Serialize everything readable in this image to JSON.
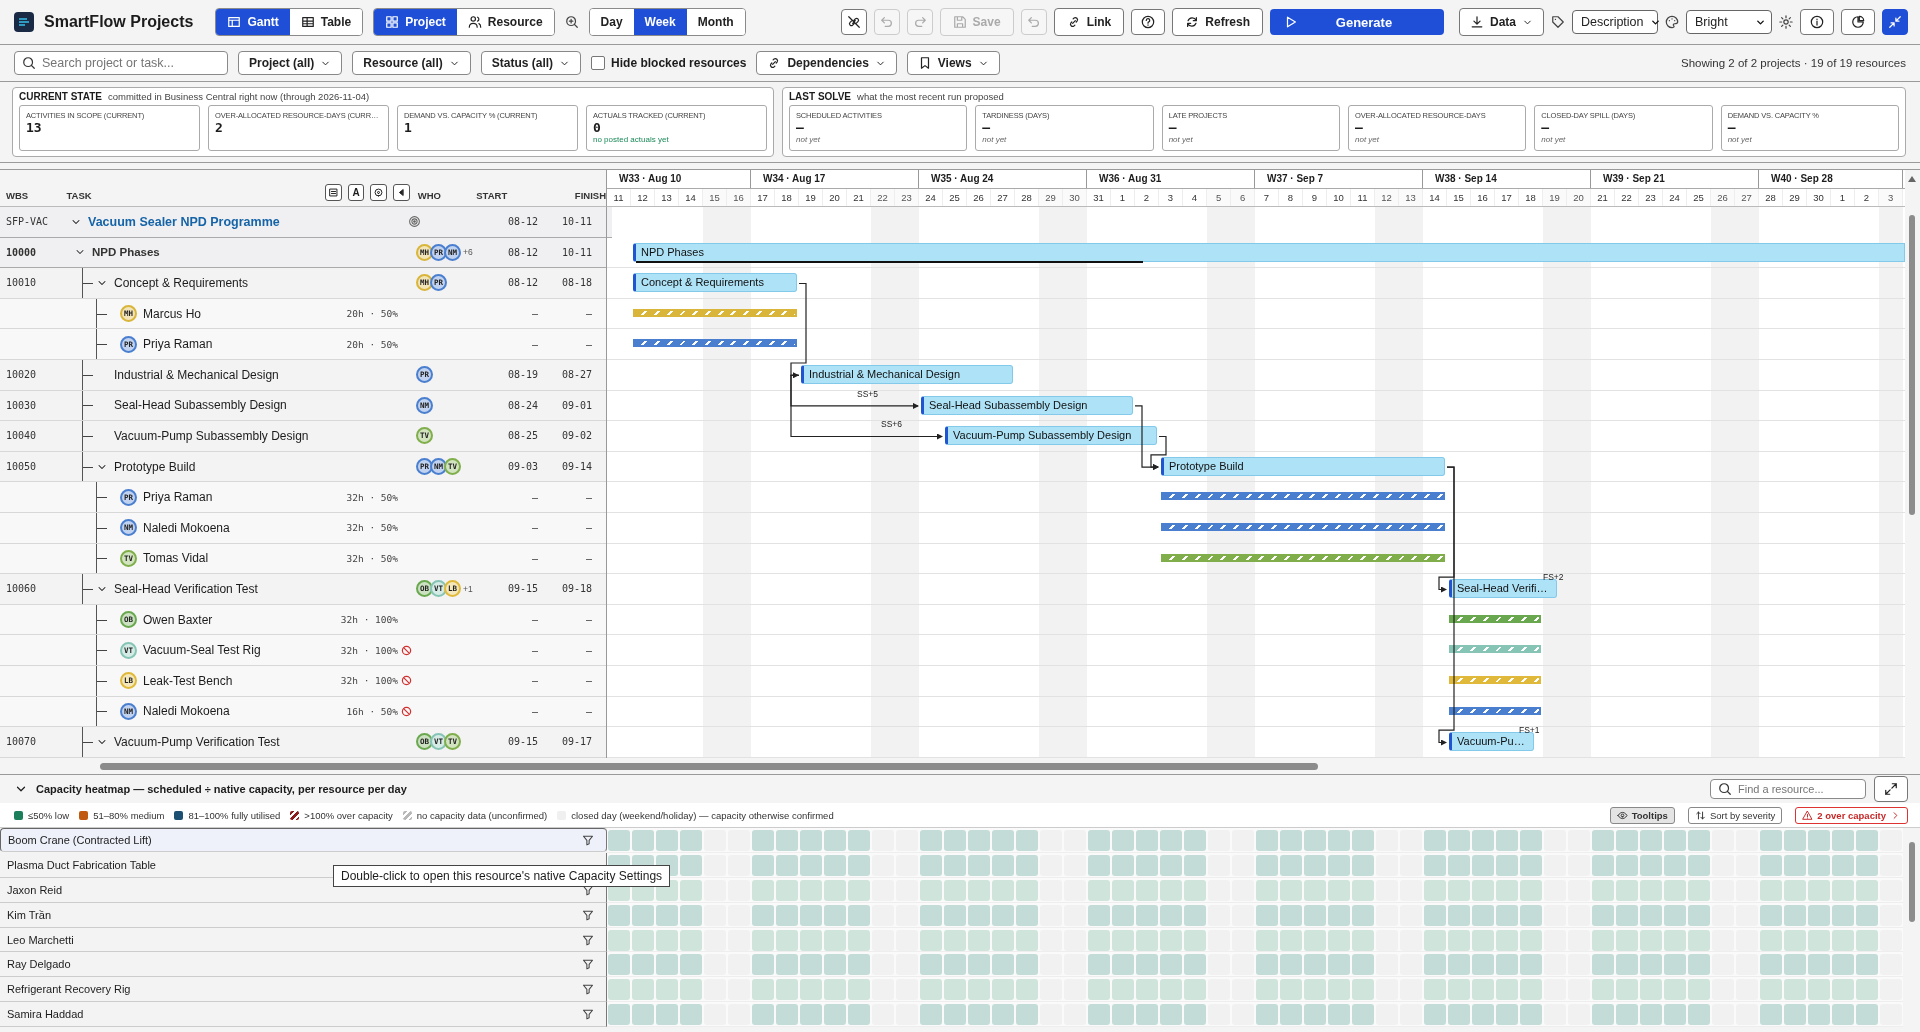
{
  "app": {
    "title": "SmartFlow Projects"
  },
  "view_tabs": [
    {
      "label": "Gantt",
      "selected": true
    },
    {
      "label": "Table",
      "selected": false
    }
  ],
  "mode_tabs": [
    {
      "label": "Project",
      "selected": true
    },
    {
      "label": "Resource",
      "selected": false
    }
  ],
  "scale_tabs": [
    {
      "label": "Day",
      "selected": false
    },
    {
      "label": "Week",
      "selected": true
    },
    {
      "label": "Month",
      "selected": false
    }
  ],
  "toolbar": {
    "undo_disabled": true,
    "redo_disabled": true,
    "save": {
      "label": "Save",
      "disabled": true
    },
    "revert_disabled": true,
    "link": "Link",
    "refresh": "Refresh",
    "generate": "Generate",
    "data": "Data",
    "label_select": "Description",
    "theme_select": "Bright"
  },
  "filters": {
    "search": {
      "placeholder": "Search project or task..."
    },
    "dropdowns": [
      "Project (all)",
      "Resource (all)",
      "Status (all)"
    ],
    "hide_blocked": {
      "label": "Hide blocked resources",
      "checked": false
    },
    "dependencies": "Dependencies",
    "views": "Views",
    "summary": "Showing 2 of 2 projects · 19 of 19 resources"
  },
  "current_state": {
    "title": "CURRENT STATE",
    "subtitle": "committed in Business Central right now (through 2026-11-04)",
    "cards": [
      {
        "label": "ACTIVITIES IN SCOPE (CURRENT)",
        "value": "13"
      },
      {
        "label": "OVER-ALLOCATED RESOURCE-DAYS (CURR…",
        "value": "2"
      },
      {
        "label": "DEMAND VS. CAPACITY % (CURRENT)",
        "value": "1"
      },
      {
        "label": "ACTUALS TRACKED (CURRENT)",
        "value": "0",
        "note": "no posted actuals yet"
      }
    ]
  },
  "last_solve": {
    "title": "LAST SOLVE",
    "subtitle": "what the most recent run proposed",
    "cards": [
      {
        "label": "SCHEDULED ACTIVITIES",
        "value": "—",
        "note": "not yet"
      },
      {
        "label": "TARDINESS (DAYS)",
        "value": "—",
        "note": "not yet"
      },
      {
        "label": "LATE PROJECTS",
        "value": "—",
        "note": "not yet"
      },
      {
        "label": "OVER-ALLOCATED RESOURCE-DAYS",
        "value": "—",
        "note": "not yet"
      },
      {
        "label": "CLOSED-DAY SPILL (DAYS)",
        "value": "—",
        "note": "not yet"
      },
      {
        "label": "DEMAND VS. CAPACITY %",
        "value": "—",
        "note": "not yet"
      }
    ]
  },
  "timeline": {
    "weeks": [
      {
        "label": "W33 · Aug 10",
        "days": [
          {
            "label": "11",
            "closed": false
          },
          {
            "label": "12",
            "closed": false
          },
          {
            "label": "13",
            "closed": false
          },
          {
            "label": "14",
            "closed": false
          },
          {
            "label": "15",
            "closed": true
          },
          {
            "label": "16",
            "closed": true
          }
        ]
      },
      {
        "label": "W34 · Aug 17",
        "days": [
          {
            "label": "17",
            "closed": false
          },
          {
            "label": "18",
            "closed": false
          },
          {
            "label": "19",
            "closed": false
          },
          {
            "label": "20",
            "closed": false
          },
          {
            "label": "21",
            "closed": false
          },
          {
            "label": "22",
            "closed": true
          },
          {
            "label": "23",
            "closed": true
          }
        ]
      },
      {
        "label": "W35 · Aug 24",
        "days": [
          {
            "label": "24",
            "closed": false
          },
          {
            "label": "25",
            "closed": false
          },
          {
            "label": "26",
            "closed": false
          },
          {
            "label": "27",
            "closed": false
          },
          {
            "label": "28",
            "closed": false
          },
          {
            "label": "29",
            "closed": true
          },
          {
            "label": "30",
            "closed": true
          }
        ]
      },
      {
        "label": "W36 · Aug 31",
        "days": [
          {
            "label": "31",
            "closed": false
          },
          {
            "label": "1",
            "closed": false
          },
          {
            "label": "2",
            "closed": false
          },
          {
            "label": "3",
            "closed": false
          },
          {
            "label": "4",
            "closed": false
          },
          {
            "label": "5",
            "closed": true
          },
          {
            "label": "6",
            "closed": true
          }
        ]
      },
      {
        "label": "W37 · Sep 7",
        "days": [
          {
            "label": "7",
            "closed": false
          },
          {
            "label": "8",
            "closed": false
          },
          {
            "label": "9",
            "closed": false
          },
          {
            "label": "10",
            "closed": false
          },
          {
            "label": "11",
            "closed": false
          },
          {
            "label": "12",
            "closed": true
          },
          {
            "label": "13",
            "closed": true
          }
        ]
      },
      {
        "label": "W38 · Sep 14",
        "days": [
          {
            "label": "14",
            "closed": false
          },
          {
            "label": "15",
            "closed": false
          },
          {
            "label": "16",
            "closed": false
          },
          {
            "label": "17",
            "closed": false
          },
          {
            "label": "18",
            "closed": false
          },
          {
            "label": "19",
            "closed": true
          },
          {
            "label": "20",
            "closed": true
          }
        ]
      },
      {
        "label": "W39 · Sep 21",
        "days": [
          {
            "label": "21",
            "closed": false
          },
          {
            "label": "22",
            "closed": false
          },
          {
            "label": "23",
            "closed": false
          },
          {
            "label": "24",
            "closed": false
          },
          {
            "label": "25",
            "closed": false
          },
          {
            "label": "26",
            "closed": true
          },
          {
            "label": "27",
            "closed": true
          }
        ]
      },
      {
        "label": "W40 · Sep 28",
        "days": [
          {
            "label": "28",
            "closed": false
          },
          {
            "label": "29",
            "closed": false
          },
          {
            "label": "30",
            "closed": false
          },
          {
            "label": "1",
            "closed": false
          },
          {
            "label": "2",
            "closed": false
          },
          {
            "label": "3",
            "closed": true
          }
        ]
      }
    ]
  },
  "gantt": {
    "columns": [
      "WBS",
      "TASK",
      "WHO",
      "START",
      "FINISH"
    ],
    "font_toggle": "A",
    "rows": [
      {
        "kind": "project",
        "wbs": "SFP-VAC",
        "name": "Vacuum Sealer NPD Programme",
        "start": "08-12",
        "finish": "10-11",
        "expanded": true,
        "children": [
          {
            "kind": "summary",
            "wbs": "10000",
            "name": "NPD Phases",
            "bar_label": "NPD Phases",
            "level": 0.4,
            "who": [
              {
                "initials": "MH",
                "color": "#d9b53a"
              },
              {
                "initials": "PR",
                "color": "#4a7fd0"
              },
              {
                "initials": "NM",
                "color": "#4a7fd0"
              }
            ],
            "more": "+6",
            "start": "08-12",
            "finish": "10-11",
            "expanded": true,
            "children": [
              {
                "kind": "task",
                "wbs": "10010",
                "name": "Concept & Requirements",
                "bar_label": "Concept & Requirements",
                "who": [
                  {
                    "initials": "MH",
                    "color": "#d9b53a"
                  },
                  {
                    "initials": "PR",
                    "color": "#4a7fd0"
                  }
                ],
                "start": "08-12",
                "finish": "08-18",
                "expanded": true,
                "children": [
                  {
                    "kind": "assignment",
                    "name": "Marcus Ho",
                    "initials": "MH",
                    "color": "#d9b53a",
                    "hours": "20h · 50%",
                    "blocked": false,
                    "start": "–",
                    "finish": "–"
                  },
                  {
                    "kind": "assignment",
                    "name": "Priya Raman",
                    "initials": "PR",
                    "color": "#4a7fd0",
                    "hours": "20h · 50%",
                    "blocked": false,
                    "start": "–",
                    "finish": "–"
                  }
                ]
              },
              {
                "kind": "task",
                "wbs": "10020",
                "name": "Industrial & Mechanical Design",
                "bar_label": "Industrial & Mechanical Design",
                "who": [
                  {
                    "initials": "PR",
                    "color": "#4a7fd0"
                  }
                ],
                "start": "08-19",
                "finish": "08-27"
              },
              {
                "kind": "task",
                "wbs": "10030",
                "name": "Seal-Head Subassembly Design",
                "bar_label": "Seal-Head Subassembly Design",
                "who": [
                  {
                    "initials": "NM",
                    "color": "#4a7fd0"
                  }
                ],
                "start": "08-24",
                "finish": "09-01",
                "lag": {
                  "kind": "SS",
                  "label": "SS+5"
                }
              },
              {
                "kind": "task",
                "wbs": "10040",
                "name": "Vacuum-Pump Subassembly Design",
                "bar_label": "Vacuum-Pump Subassembly Design",
                "who": [
                  {
                    "initials": "TV",
                    "color": "#7fae4a"
                  }
                ],
                "start": "08-25",
                "finish": "09-02",
                "lag": {
                  "kind": "SS",
                  "label": "SS+6"
                }
              },
              {
                "kind": "task",
                "wbs": "10050",
                "name": "Prototype Build",
                "bar_label": "Prototype Build",
                "who": [
                  {
                    "initials": "PR",
                    "color": "#4a7fd0"
                  },
                  {
                    "initials": "NM",
                    "color": "#4a7fd0"
                  },
                  {
                    "initials": "TV",
                    "color": "#7fae4a"
                  }
                ],
                "start": "09-03",
                "finish": "09-14",
                "expanded": true,
                "children": [
                  {
                    "kind": "assignment",
                    "name": "Priya Raman",
                    "initials": "PR",
                    "color": "#4a7fd0",
                    "hours": "32h · 50%",
                    "blocked": false,
                    "start": "–",
                    "finish": "–"
                  },
                  {
                    "kind": "assignment",
                    "name": "Naledi Mokoena",
                    "initials": "NM",
                    "color": "#4a7fd0",
                    "hours": "32h · 50%",
                    "blocked": false,
                    "start": "–",
                    "finish": "–"
                  },
                  {
                    "kind": "assignment",
                    "name": "Tomas Vidal",
                    "initials": "TV",
                    "color": "#7fae4a",
                    "hours": "32h · 50%",
                    "blocked": false,
                    "start": "–",
                    "finish": "–"
                  }
                ]
              },
              {
                "kind": "task",
                "wbs": "10060",
                "name": "Seal-Head Verification Test",
                "bar_label": "Seal-Head Verifi…",
                "who": [
                  {
                    "initials": "OB",
                    "color": "#6aa84f"
                  },
                  {
                    "initials": "VT",
                    "color": "#86c5b5"
                  },
                  {
                    "initials": "LB",
                    "color": "#e0b93a"
                  }
                ],
                "more": "+1",
                "start": "09-15",
                "finish": "09-18",
                "expanded": true,
                "lag": {
                  "kind": "FS",
                  "label": "FS+2"
                },
                "children": [
                  {
                    "kind": "assignment",
                    "name": "Owen Baxter",
                    "initials": "OB",
                    "color": "#6aa84f",
                    "hours": "32h · 100%",
                    "blocked": false,
                    "start": "–",
                    "finish": "–"
                  },
                  {
                    "kind": "assignment",
                    "name": "Vacuum-Seal Test Rig",
                    "initials": "VT",
                    "color": "#86c5b5",
                    "hours": "32h · 100%",
                    "blocked": true,
                    "start": "–",
                    "finish": "–"
                  },
                  {
                    "kind": "assignment",
                    "name": "Leak-Test Bench",
                    "initials": "LB",
                    "color": "#e0b93a",
                    "hours": "32h · 100%",
                    "blocked": true,
                    "start": "–",
                    "finish": "–"
                  },
                  {
                    "kind": "assignment",
                    "name": "Naledi Mokoena",
                    "initials": "NM",
                    "color": "#4a7fd0",
                    "hours": "16h · 50%",
                    "blocked": true,
                    "start": "–",
                    "finish": "–"
                  }
                ]
              },
              {
                "kind": "task",
                "wbs": "10070",
                "name": "Vacuum-Pump Verification Test",
                "bar_label": "Vacuum-Pu…",
                "who": [
                  {
                    "initials": "OB",
                    "color": "#6aa84f"
                  },
                  {
                    "initials": "VT",
                    "color": "#86c5b5"
                  },
                  {
                    "initials": "TV",
                    "color": "#7fae4a"
                  }
                ],
                "start": "09-15",
                "finish": "09-17",
                "expanded": true,
                "lag": {
                  "kind": "FS",
                  "label": "FS+1"
                }
              }
            ]
          }
        ]
      }
    ]
  },
  "heatmap": {
    "title": "Capacity heatmap — scheduled ÷ native capacity, per resource per day",
    "expanded": true,
    "search": {
      "placeholder": "Find a resource..."
    },
    "legend": [
      {
        "kind": "solid",
        "color": "#1a7f5a",
        "label": "≤50% low"
      },
      {
        "kind": "solid",
        "color": "#c05a10",
        "label": "51–80% medium"
      },
      {
        "kind": "solid",
        "color": "#1d4f73",
        "label": "81–100% fully utilised"
      },
      {
        "kind": "hatch",
        "color": "#8b1c1c",
        "label": ">100% over capacity"
      },
      {
        "kind": "hatch",
        "color": "#b8b8b8",
        "label": "no capacity data (unconfirmed)"
      },
      {
        "kind": "closed",
        "color": "#f0f0f0",
        "label": "closed day (weekend/holiday) — capacity otherwise confirmed"
      }
    ],
    "tooltips": {
      "label": "Tooltips",
      "selected": true
    },
    "sort": "Sort by severity",
    "over_capacity": "2 over capacity",
    "rows": [
      {
        "name": "Boom Crane (Contracted Lift)",
        "color": "#c3dcd7",
        "selected": true
      },
      {
        "name": "Plasma Duct Fabrication Table",
        "color": "#c3dcd7",
        "selected": false,
        "tooltip": "Double-click to open this resource's native Capacity Settings"
      },
      {
        "name": "Jaxon Reid",
        "color": "#cfe5dc",
        "selected": false
      },
      {
        "name": "Kim Trần",
        "color": "#c3dcd7",
        "selected": false
      },
      {
        "name": "Leo Marchetti",
        "color": "#cfe5dc",
        "selected": false
      },
      {
        "name": "Ray Delgado",
        "color": "#c3dcd7",
        "selected": false
      },
      {
        "name": "Refrigerant Recovery Rig",
        "color": "#cfe5dc",
        "selected": false
      },
      {
        "name": "Samira Haddad",
        "color": "#c3dcd7",
        "selected": false
      }
    ]
  }
}
